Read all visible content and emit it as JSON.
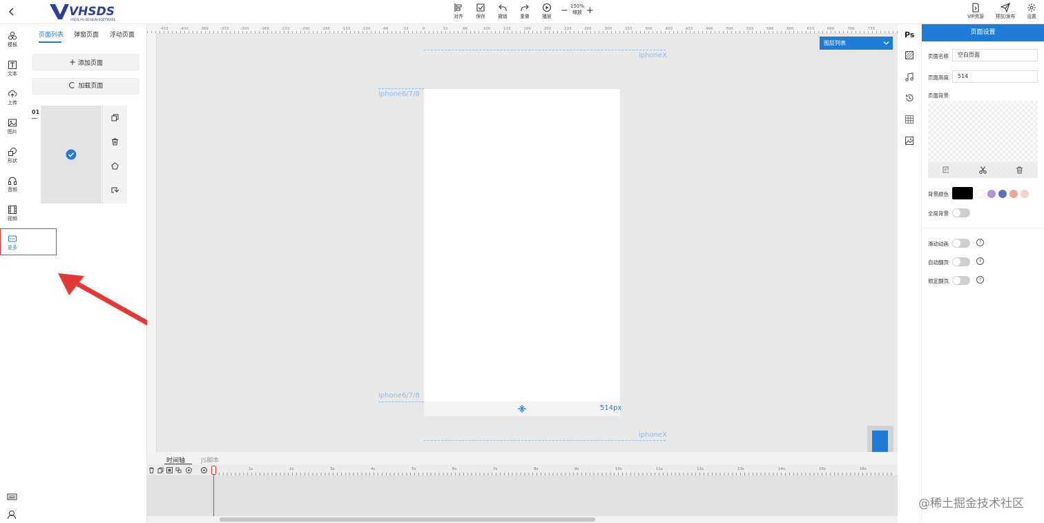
{
  "topbar": {
    "logo_text": "VHSDS",
    "logo_sub": "HSDS.AS-DESIGN-SOFTWARE",
    "tools": [
      {
        "label": "对齐",
        "icon": "align-icon"
      },
      {
        "label": "保存",
        "icon": "save-icon"
      },
      {
        "label": "撤销",
        "icon": "undo-icon"
      },
      {
        "label": "重做",
        "icon": "redo-icon"
      },
      {
        "label": "播放",
        "icon": "play-icon"
      }
    ],
    "zoom_minus": "−",
    "zoom_value": "150%",
    "zoom_label": "缩放",
    "zoom_plus": "+",
    "right_tools": [
      {
        "label": "VIP资源",
        "icon": "vip-resource-icon"
      },
      {
        "label": "预览/发布",
        "icon": "publish-icon"
      },
      {
        "label": "设置",
        "icon": "gear-icon"
      }
    ]
  },
  "rail": {
    "items": [
      {
        "label": "模板",
        "icon": "template-icon"
      },
      {
        "label": "文本",
        "icon": "text-icon"
      },
      {
        "label": "上传",
        "icon": "upload-icon"
      },
      {
        "label": "图片",
        "icon": "image-icon"
      },
      {
        "label": "形状",
        "icon": "shape-icon"
      },
      {
        "label": "音频",
        "icon": "audio-icon"
      },
      {
        "label": "视频",
        "icon": "video-icon"
      },
      {
        "label": "更多",
        "icon": "more-icon"
      }
    ]
  },
  "pages_panel": {
    "tabs": [
      "页面列表",
      "弹窗页面",
      "浮动页面"
    ],
    "add_page": "添加页面",
    "load_page": "加载页面",
    "page_number": "01"
  },
  "canvas": {
    "ruler_top": [
      "-433",
      "-400",
      "-366",
      "-333",
      "-300",
      "-266",
      "-233",
      "-200",
      "-166",
      "-133",
      "-100",
      "-66",
      "-33",
      "0",
      "33",
      "66",
      "100",
      "133",
      "166",
      "200",
      "233",
      "266",
      "300",
      "333",
      "366",
      "400",
      "433",
      "466",
      "500",
      "533",
      "566",
      "600",
      "633",
      "666",
      "700",
      "733"
    ],
    "guides": {
      "top": "iphoneX",
      "upper": "iphone6/7/8",
      "lower": "iphone6/7/8",
      "bottom": "iphoneX"
    },
    "page_height_label": "514px",
    "layer_list": "图层列表"
  },
  "timeline": {
    "tabs": [
      "时间轴",
      "JS脚本"
    ],
    "seconds": [
      "1s",
      "2s",
      "3s",
      "4s",
      "5s",
      "6s",
      "7s",
      "8s",
      "9s",
      "10s",
      "11s",
      "12s",
      "13s",
      "14s",
      "15s",
      "16s"
    ]
  },
  "right_icons": {
    "ps": "Ps"
  },
  "properties": {
    "header": "页面设置",
    "name_label": "页面名称",
    "name_value": "空白页面",
    "height_label": "页面高度",
    "height_value": "514",
    "bg_label": "页面背景",
    "bg_color_label": "背景颜色",
    "global_bg_label": "全局背景",
    "slide_anim_label": "滑动动画",
    "auto_flip_label": "自动翻页",
    "lock_flip_label": "锁定翻页",
    "swatches": [
      "#ffffff",
      "#b295d6",
      "#5b6fc4",
      "#e8a99a",
      "#f2d3cd"
    ]
  },
  "watermark": "@稀土掘金技术社区"
}
